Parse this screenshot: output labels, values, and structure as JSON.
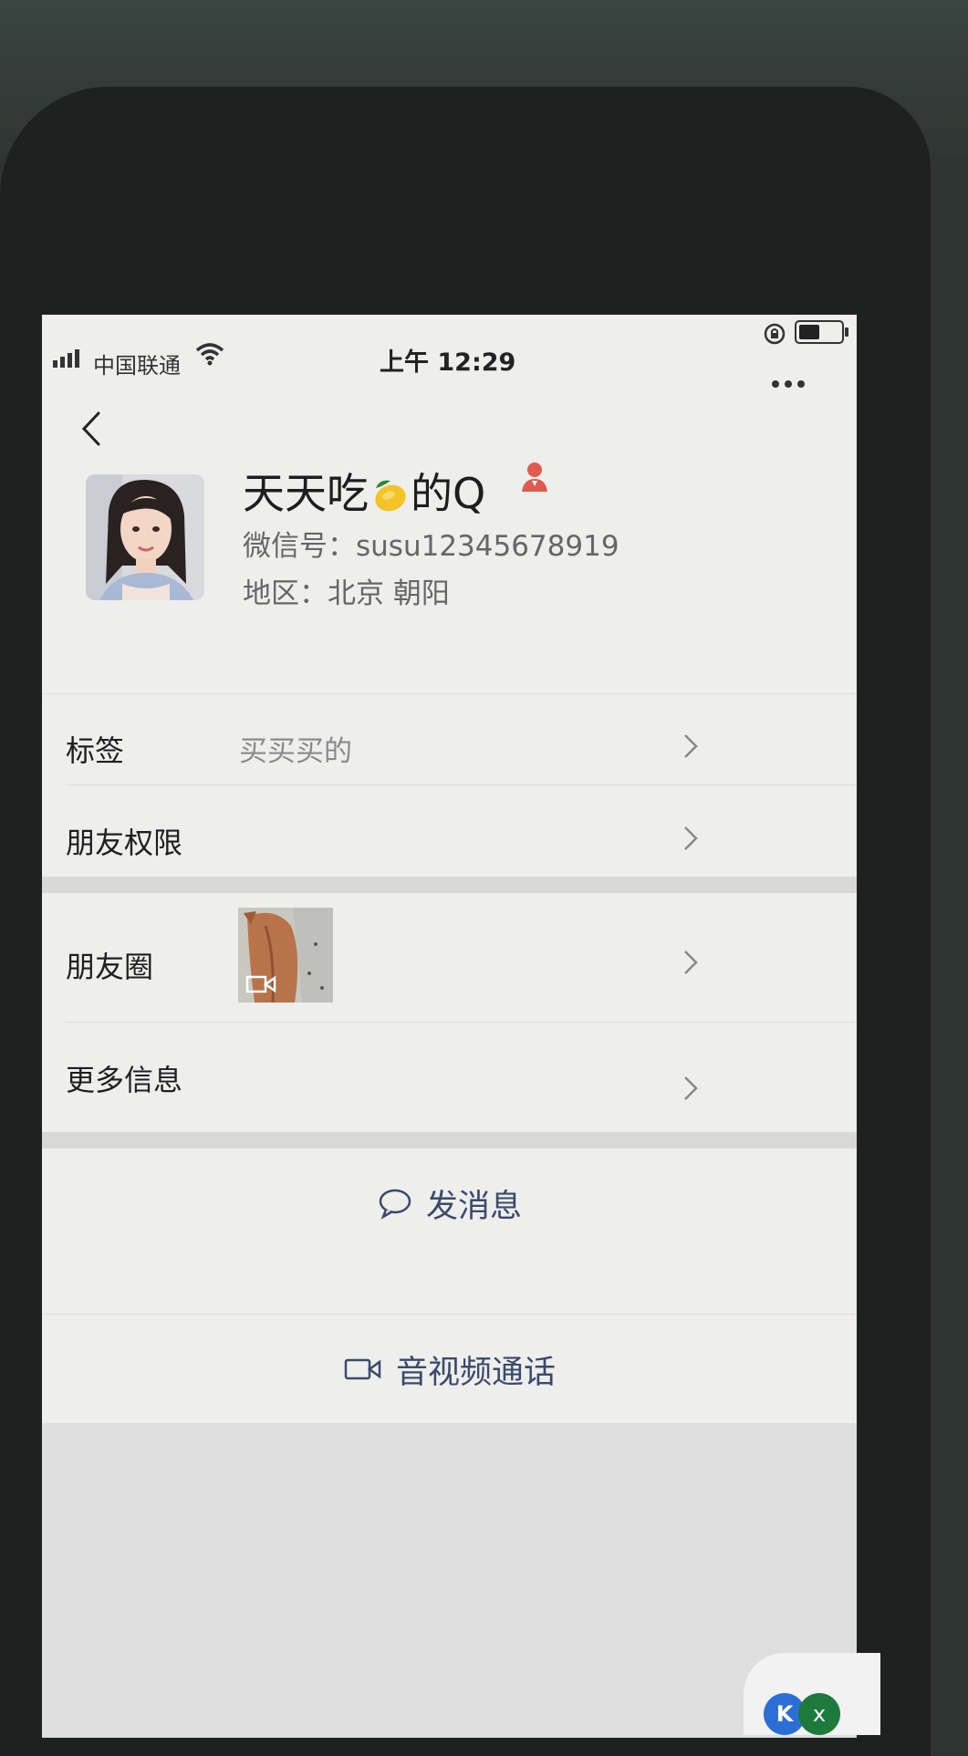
{
  "status_bar": {
    "carrier": "中国联通",
    "time": "上午 12:29"
  },
  "profile": {
    "name_part1": "天天吃",
    "name_part2": "的Q",
    "wechat_id_label": "微信号：",
    "wechat_id": "susu12345678919",
    "region_label": "地区：",
    "region": "北京 朝阳"
  },
  "rows": {
    "tag_label": "标签",
    "tag_value": "买买买的",
    "permissions_label": "朋友权限",
    "moments_label": "朋友圈",
    "more_info_label": "更多信息"
  },
  "actions": {
    "message_label": "发消息",
    "call_label": "音视频通话"
  },
  "colors": {
    "action_text": "#3b4a6b",
    "screen_bg": "#eeeeec",
    "badge": "#e05a4f"
  },
  "icons": [
    "signal-icon",
    "wifi-icon",
    "lock-rotation-icon",
    "battery-icon",
    "back-arrow-icon",
    "more-icon",
    "lemon-emoji-icon",
    "verified-badge-icon",
    "chevron-right-icon",
    "chat-bubble-icon",
    "video-camera-icon"
  ]
}
